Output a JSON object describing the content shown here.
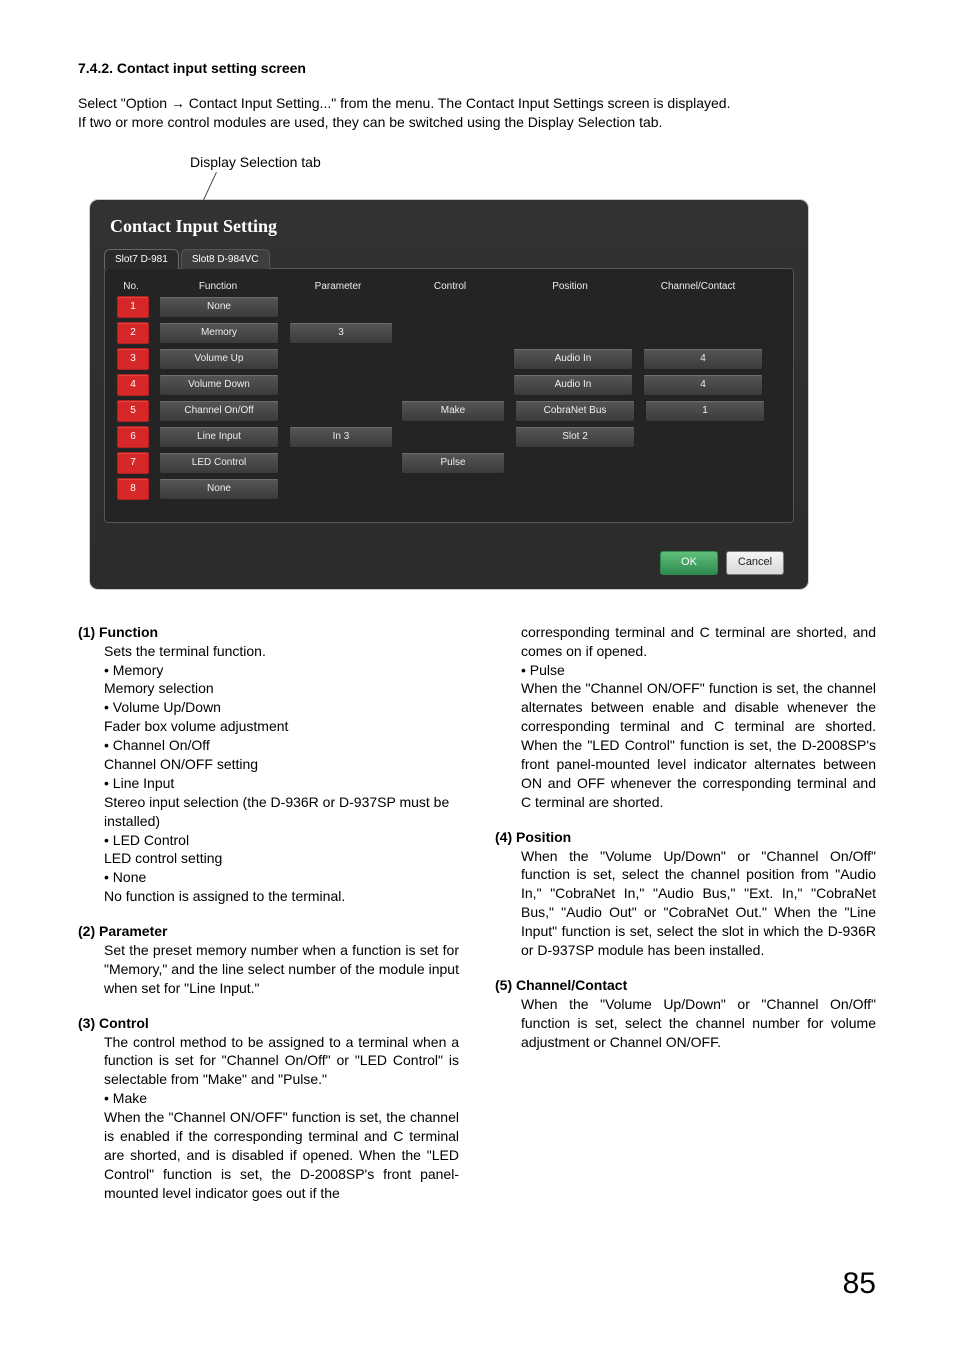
{
  "header": {
    "section_title": "7.4.2. Contact input setting screen",
    "intro_line1": "Select \"Option → Contact Input Setting...\" from the menu. The Contact Input Settings screen is displayed.",
    "intro_line2": "If two or more control modules are used, they can be switched using the Display Selection tab.",
    "callout_label": "Display Selection tab"
  },
  "window": {
    "title": "Contact Input Setting",
    "tabs": [
      {
        "label": "Slot7  D-981",
        "active": true
      },
      {
        "label": "Slot8  D-984VC",
        "active": false
      }
    ],
    "columns": {
      "no": "No.",
      "function": "Function",
      "parameter": "Parameter",
      "control": "Control",
      "position": "Position",
      "channel_contact": "Channel/Contact"
    },
    "rows": [
      {
        "no": "1",
        "function": "None"
      },
      {
        "no": "2",
        "function": "Memory",
        "parameter": "3"
      },
      {
        "no": "3",
        "function": "Volume Up",
        "position": "Audio In",
        "channel_contact": "4"
      },
      {
        "no": "4",
        "function": "Volume Down",
        "position": "Audio In",
        "channel_contact": "4"
      },
      {
        "no": "5",
        "function": "Channel On/Off",
        "control": "Make",
        "position": "CobraNet Bus",
        "channel_contact": "1"
      },
      {
        "no": "6",
        "function": "Line Input",
        "parameter": "In 3",
        "position": "Slot 2"
      },
      {
        "no": "7",
        "function": "LED Control",
        "control": "Pulse"
      },
      {
        "no": "8",
        "function": "None"
      }
    ],
    "buttons": {
      "ok": "OK",
      "cancel": "Cancel"
    }
  },
  "desc": {
    "s1_head": "(1) Function",
    "s1_intro": "Sets the terminal function.",
    "s1_items": [
      {
        "name": "Memory",
        "text": "Memory selection"
      },
      {
        "name": "Volume Up/Down",
        "text": "Fader box volume adjustment"
      },
      {
        "name": "Channel On/Off",
        "text": "Channel ON/OFF setting"
      },
      {
        "name": "Line Input",
        "text": "Stereo input selection (the D-936R or D-937SP must be installed)"
      },
      {
        "name": "LED Control",
        "text": "LED control setting"
      },
      {
        "name": "None",
        "text": "No function is assigned to the terminal."
      }
    ],
    "s2_head": "(2) Parameter",
    "s2_text": "Set the preset memory number when a function is set for \"Memory,\" and the line select number of the module input when set for \"Line Input.\"",
    "s3_head": "(3) Control",
    "s3_text": "The control method to be assigned to a terminal when a function is set for \"Channel On/Off\" or \"LED Control\" is selectable from \"Make\" and \"Pulse.\"",
    "s3_make_name": "Make",
    "s3_make_text_a": "When the \"Channel ON/OFF\" function is set, the channel is enabled if the corresponding terminal and C terminal are shorted, and is disabled if opened. When the \"LED Control\" function is set, the D-2008SP's front panel-mounted level indicator goes out if the",
    "s3_make_text_b": "corresponding terminal and C terminal are shorted, and comes on if opened.",
    "s3_pulse_name": "Pulse",
    "s3_pulse_text": "When the \"Channel ON/OFF\" function is set, the channel alternates between enable and disable whenever the corresponding terminal and C terminal are shorted. When the \"LED Control\" function is set, the D-2008SP's front panel-mounted level indicator alternates between ON and OFF whenever the corresponding terminal and C terminal are shorted.",
    "s4_head": "(4) Position",
    "s4_text": "When the \"Volume Up/Down\" or \"Channel On/Off\" function is set, select the channel position from \"Audio In,\" \"CobraNet In,\" \"Audio Bus,\" \"Ext. In,\" \"CobraNet Bus,\" \"Audio Out\" or \"CobraNet Out.\" When the \"Line Input\" function is set, select the slot in which the D-936R or D-937SP module has been installed.",
    "s5_head": "(5) Channel/Contact",
    "s5_text": "When the \"Volume Up/Down\" or \"Channel On/Off\" function is set, select the channel number for volume adjustment or Channel ON/OFF."
  },
  "page_number": "85"
}
